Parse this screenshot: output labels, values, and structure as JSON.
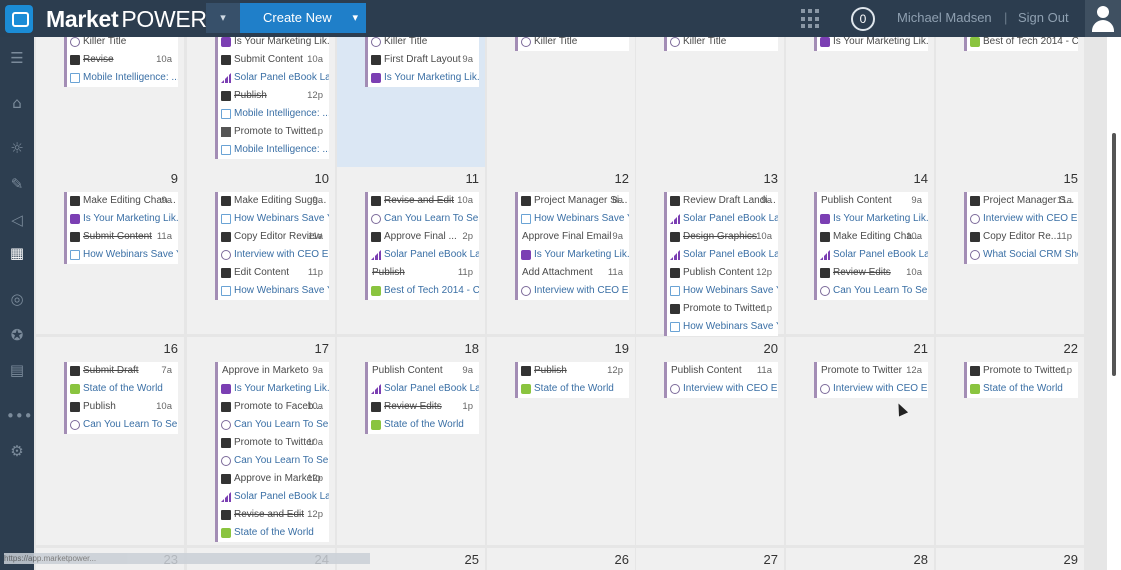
{
  "header": {
    "brand_bold": "Market",
    "brand_light": "POWER",
    "create_label": "Create New",
    "notification_count": "0",
    "user_name": "Michael Madsen",
    "separator": "|",
    "signout_label": "Sign Out"
  },
  "sidebar_icons": [
    "menu-icon",
    "home-icon",
    "lightbulb-icon",
    "pencil-icon",
    "megaphone-icon",
    "calendar-icon",
    "compass-icon",
    "star-icon",
    "report-icon",
    "more-icon",
    "settings-icon"
  ],
  "status_url": "https://app.marketpower...",
  "weeks": [
    {
      "days": [
        {
          "num": "",
          "entries": [
            {
              "icon": "wp",
              "text": "Killer Title",
              "time": ""
            },
            {
              "icon": "person",
              "text": "Revise",
              "time": "10a",
              "strike": true
            },
            {
              "icon": "doc",
              "text": "Mobile Intelligence: ...",
              "time": "",
              "sub": true
            }
          ]
        },
        {
          "num": "",
          "entries": [
            {
              "icon": "yt",
              "text": "Is Your Marketing Lik...",
              "time": ""
            },
            {
              "icon": "person",
              "text": "Submit Content",
              "time": "10a"
            },
            {
              "icon": "bars",
              "text": "Solar Panel eBook La...",
              "time": "",
              "sub": true
            },
            {
              "icon": "person",
              "text": "Publish",
              "time": "12p",
              "strike": true
            },
            {
              "icon": "doc",
              "text": "Mobile Intelligence: ...",
              "time": "",
              "sub": true
            },
            {
              "icon": "person2",
              "text": "Promote to Twitter",
              "time": "1p"
            },
            {
              "icon": "doc",
              "text": "Mobile Intelligence: ...",
              "time": "",
              "sub": true
            }
          ]
        },
        {
          "num": "",
          "today": true,
          "entries": [
            {
              "icon": "wp",
              "text": "Killer Title",
              "time": ""
            },
            {
              "icon": "person",
              "text": "First Draft Layout",
              "time": "9a"
            },
            {
              "icon": "yt",
              "text": "Is Your Marketing Lik...",
              "time": "",
              "sub": true
            }
          ]
        },
        {
          "num": "",
          "entries": [
            {
              "icon": "wp",
              "text": "Killer Title",
              "time": ""
            }
          ]
        },
        {
          "num": "",
          "entries": [
            {
              "icon": "wp",
              "text": "Killer Title",
              "time": ""
            }
          ]
        },
        {
          "num": "",
          "entries": [
            {
              "icon": "yt",
              "text": "Is Your Marketing Lik...",
              "time": ""
            }
          ]
        },
        {
          "num": "",
          "entries": [
            {
              "icon": "slide",
              "text": "Best of Tech 2014 - CES",
              "time": ""
            }
          ]
        }
      ]
    },
    {
      "days": [
        {
          "num": "9",
          "entries": [
            {
              "icon": "person",
              "text": "Make Editing Chan...",
              "time": "9a"
            },
            {
              "icon": "yt",
              "text": "Is Your Marketing Lik...",
              "time": "",
              "sub": true
            },
            {
              "icon": "person",
              "text": "Submit Content",
              "time": "11a",
              "strike": true
            },
            {
              "icon": "doc",
              "text": "How Webinars Save Y...",
              "time": "",
              "sub": true
            }
          ]
        },
        {
          "num": "10",
          "entries": [
            {
              "icon": "person",
              "text": "Make Editing Sugg...",
              "time": "9a"
            },
            {
              "icon": "doc",
              "text": "How Webinars Save Y...",
              "time": "",
              "sub": true
            },
            {
              "icon": "person",
              "text": "Copy Editor Review",
              "time": "11a"
            },
            {
              "icon": "wp",
              "text": "Interview with CEO Er...",
              "time": "",
              "sub": true
            },
            {
              "icon": "person",
              "text": "Edit Content",
              "time": "11p"
            },
            {
              "icon": "doc",
              "text": "How Webinars Save Y...",
              "time": "",
              "sub": true
            }
          ]
        },
        {
          "num": "11",
          "entries": [
            {
              "icon": "person",
              "text": "Revise and Edit",
              "time": "10a",
              "strike": true
            },
            {
              "icon": "wp",
              "text": "Can You Learn To Sell?",
              "time": "",
              "sub": true
            },
            {
              "icon": "person",
              "text": "Approve Final ...",
              "time": "2p"
            },
            {
              "icon": "bars",
              "text": "Solar Panel eBook La...",
              "time": "",
              "sub": true
            },
            {
              "icon": "none",
              "text": "Publish",
              "time": "11p",
              "strike": true
            },
            {
              "icon": "slide",
              "text": "Best of Tech 2014 - CES",
              "time": "",
              "sub": true
            }
          ]
        },
        {
          "num": "12",
          "entries": [
            {
              "icon": "person",
              "text": "Project Manager Si...",
              "time": "8a"
            },
            {
              "icon": "doc",
              "text": "How Webinars Save Y...",
              "time": "",
              "sub": true
            },
            {
              "icon": "none",
              "text": "Approve Final Email",
              "time": "9a"
            },
            {
              "icon": "yt",
              "text": "Is Your Marketing Lik...",
              "time": "",
              "sub": true
            },
            {
              "icon": "none",
              "text": "Add Attachment",
              "time": "11a"
            },
            {
              "icon": "wp",
              "text": "Interview with CEO Er...",
              "time": "",
              "sub": true
            }
          ]
        },
        {
          "num": "13",
          "entries": [
            {
              "icon": "person",
              "text": "Review Draft Landi...",
              "time": "9a"
            },
            {
              "icon": "bars",
              "text": "Solar Panel eBook La...",
              "time": "",
              "sub": true
            },
            {
              "icon": "person",
              "text": "Design Graphics",
              "time": "10a",
              "strike": true
            },
            {
              "icon": "bars",
              "text": "Solar Panel eBook La...",
              "time": "",
              "sub": true
            },
            {
              "icon": "person",
              "text": "Publish Content",
              "time": "12p"
            },
            {
              "icon": "doc",
              "text": "How Webinars Save Y...",
              "time": "",
              "sub": true
            },
            {
              "icon": "person",
              "text": "Promote to Twitter",
              "time": "1p"
            },
            {
              "icon": "doc",
              "text": "How Webinars Save Y...",
              "time": "",
              "sub": true
            }
          ]
        },
        {
          "num": "14",
          "entries": [
            {
              "icon": "none",
              "text": "Publish Content",
              "time": "9a"
            },
            {
              "icon": "yt",
              "text": "Is Your Marketing Lik...",
              "time": "",
              "sub": true
            },
            {
              "icon": "person",
              "text": "Make Editing Cha...",
              "time": "10a"
            },
            {
              "icon": "bars",
              "text": "Solar Panel eBook La...",
              "time": "",
              "sub": true
            },
            {
              "icon": "person",
              "text": "Review Edits",
              "time": "10a",
              "strike": true
            },
            {
              "icon": "wp",
              "text": "Can You Learn To Sell?",
              "time": "",
              "sub": true
            }
          ]
        },
        {
          "num": "15",
          "entries": [
            {
              "icon": "person",
              "text": "Project Manager S...",
              "time": "11a"
            },
            {
              "icon": "wp",
              "text": "Interview with CEO Eri...",
              "time": "",
              "sub": true
            },
            {
              "icon": "person",
              "text": "Copy Editor Re...",
              "time": "11p"
            },
            {
              "icon": "wp",
              "text": "What Social CRM Sho...",
              "time": "",
              "sub": true
            }
          ]
        }
      ]
    },
    {
      "days": [
        {
          "num": "16",
          "entries": [
            {
              "icon": "person",
              "text": "Submit Draft",
              "time": "7a",
              "strike": true
            },
            {
              "icon": "slide",
              "text": "State of the World",
              "time": "",
              "sub": true
            },
            {
              "icon": "person",
              "text": "Publish",
              "time": "10a"
            },
            {
              "icon": "wp",
              "text": "Can You Learn To Sell?",
              "time": "",
              "sub": true
            }
          ]
        },
        {
          "num": "17",
          "entries": [
            {
              "icon": "none",
              "text": "Approve in Marketo",
              "time": "9a"
            },
            {
              "icon": "yt",
              "text": "Is Your Marketing Lik...",
              "time": "",
              "sub": true
            },
            {
              "icon": "person",
              "text": "Promote to Faceb...",
              "time": "10a"
            },
            {
              "icon": "wp",
              "text": "Can You Learn To Sell?",
              "time": "",
              "sub": true
            },
            {
              "icon": "person",
              "text": "Promote to Twitter",
              "time": "10a"
            },
            {
              "icon": "wp",
              "text": "Can You Learn To Sell?",
              "time": "",
              "sub": true
            },
            {
              "icon": "person",
              "text": "Approve in Marketo",
              "time": "12p"
            },
            {
              "icon": "bars",
              "text": "Solar Panel eBook La...",
              "time": "",
              "sub": true
            },
            {
              "icon": "person",
              "text": "Revise and Edit",
              "time": "12p",
              "strike": true
            },
            {
              "icon": "slide",
              "text": "State of the World",
              "time": "",
              "sub": true
            }
          ]
        },
        {
          "num": "18",
          "entries": [
            {
              "icon": "none",
              "text": "Publish Content",
              "time": "9a"
            },
            {
              "icon": "bars",
              "text": "Solar Panel eBook La...",
              "time": "",
              "sub": true
            },
            {
              "icon": "person",
              "text": "Review Edits",
              "time": "1p",
              "strike": true
            },
            {
              "icon": "slide",
              "text": "State of the World",
              "time": "",
              "sub": true
            }
          ]
        },
        {
          "num": "19",
          "entries": [
            {
              "icon": "person",
              "text": "Publish",
              "time": "12p",
              "strike": true
            },
            {
              "icon": "slide",
              "text": "State of the World",
              "time": "",
              "sub": true
            }
          ]
        },
        {
          "num": "20",
          "entries": [
            {
              "icon": "none",
              "text": "Publish Content",
              "time": "11a"
            },
            {
              "icon": "wp",
              "text": "Interview with CEO Er...",
              "time": "",
              "sub": true
            }
          ]
        },
        {
          "num": "21",
          "entries": [
            {
              "icon": "none",
              "text": "Promote to Twitter",
              "time": "12a"
            },
            {
              "icon": "wp",
              "text": "Interview with CEO Er...",
              "time": "",
              "sub": true
            }
          ]
        },
        {
          "num": "22",
          "entries": [
            {
              "icon": "person",
              "text": "Promote to Twitter",
              "time": "1p"
            },
            {
              "icon": "slide",
              "text": "State of the World",
              "time": "",
              "sub": true
            }
          ]
        }
      ]
    },
    {
      "days": [
        {
          "num": "23",
          "entries": []
        },
        {
          "num": "24",
          "entries": []
        },
        {
          "num": "25",
          "entries": []
        },
        {
          "num": "26",
          "entries": []
        },
        {
          "num": "27",
          "entries": []
        },
        {
          "num": "28",
          "entries": []
        },
        {
          "num": "29",
          "entries": []
        }
      ]
    }
  ]
}
